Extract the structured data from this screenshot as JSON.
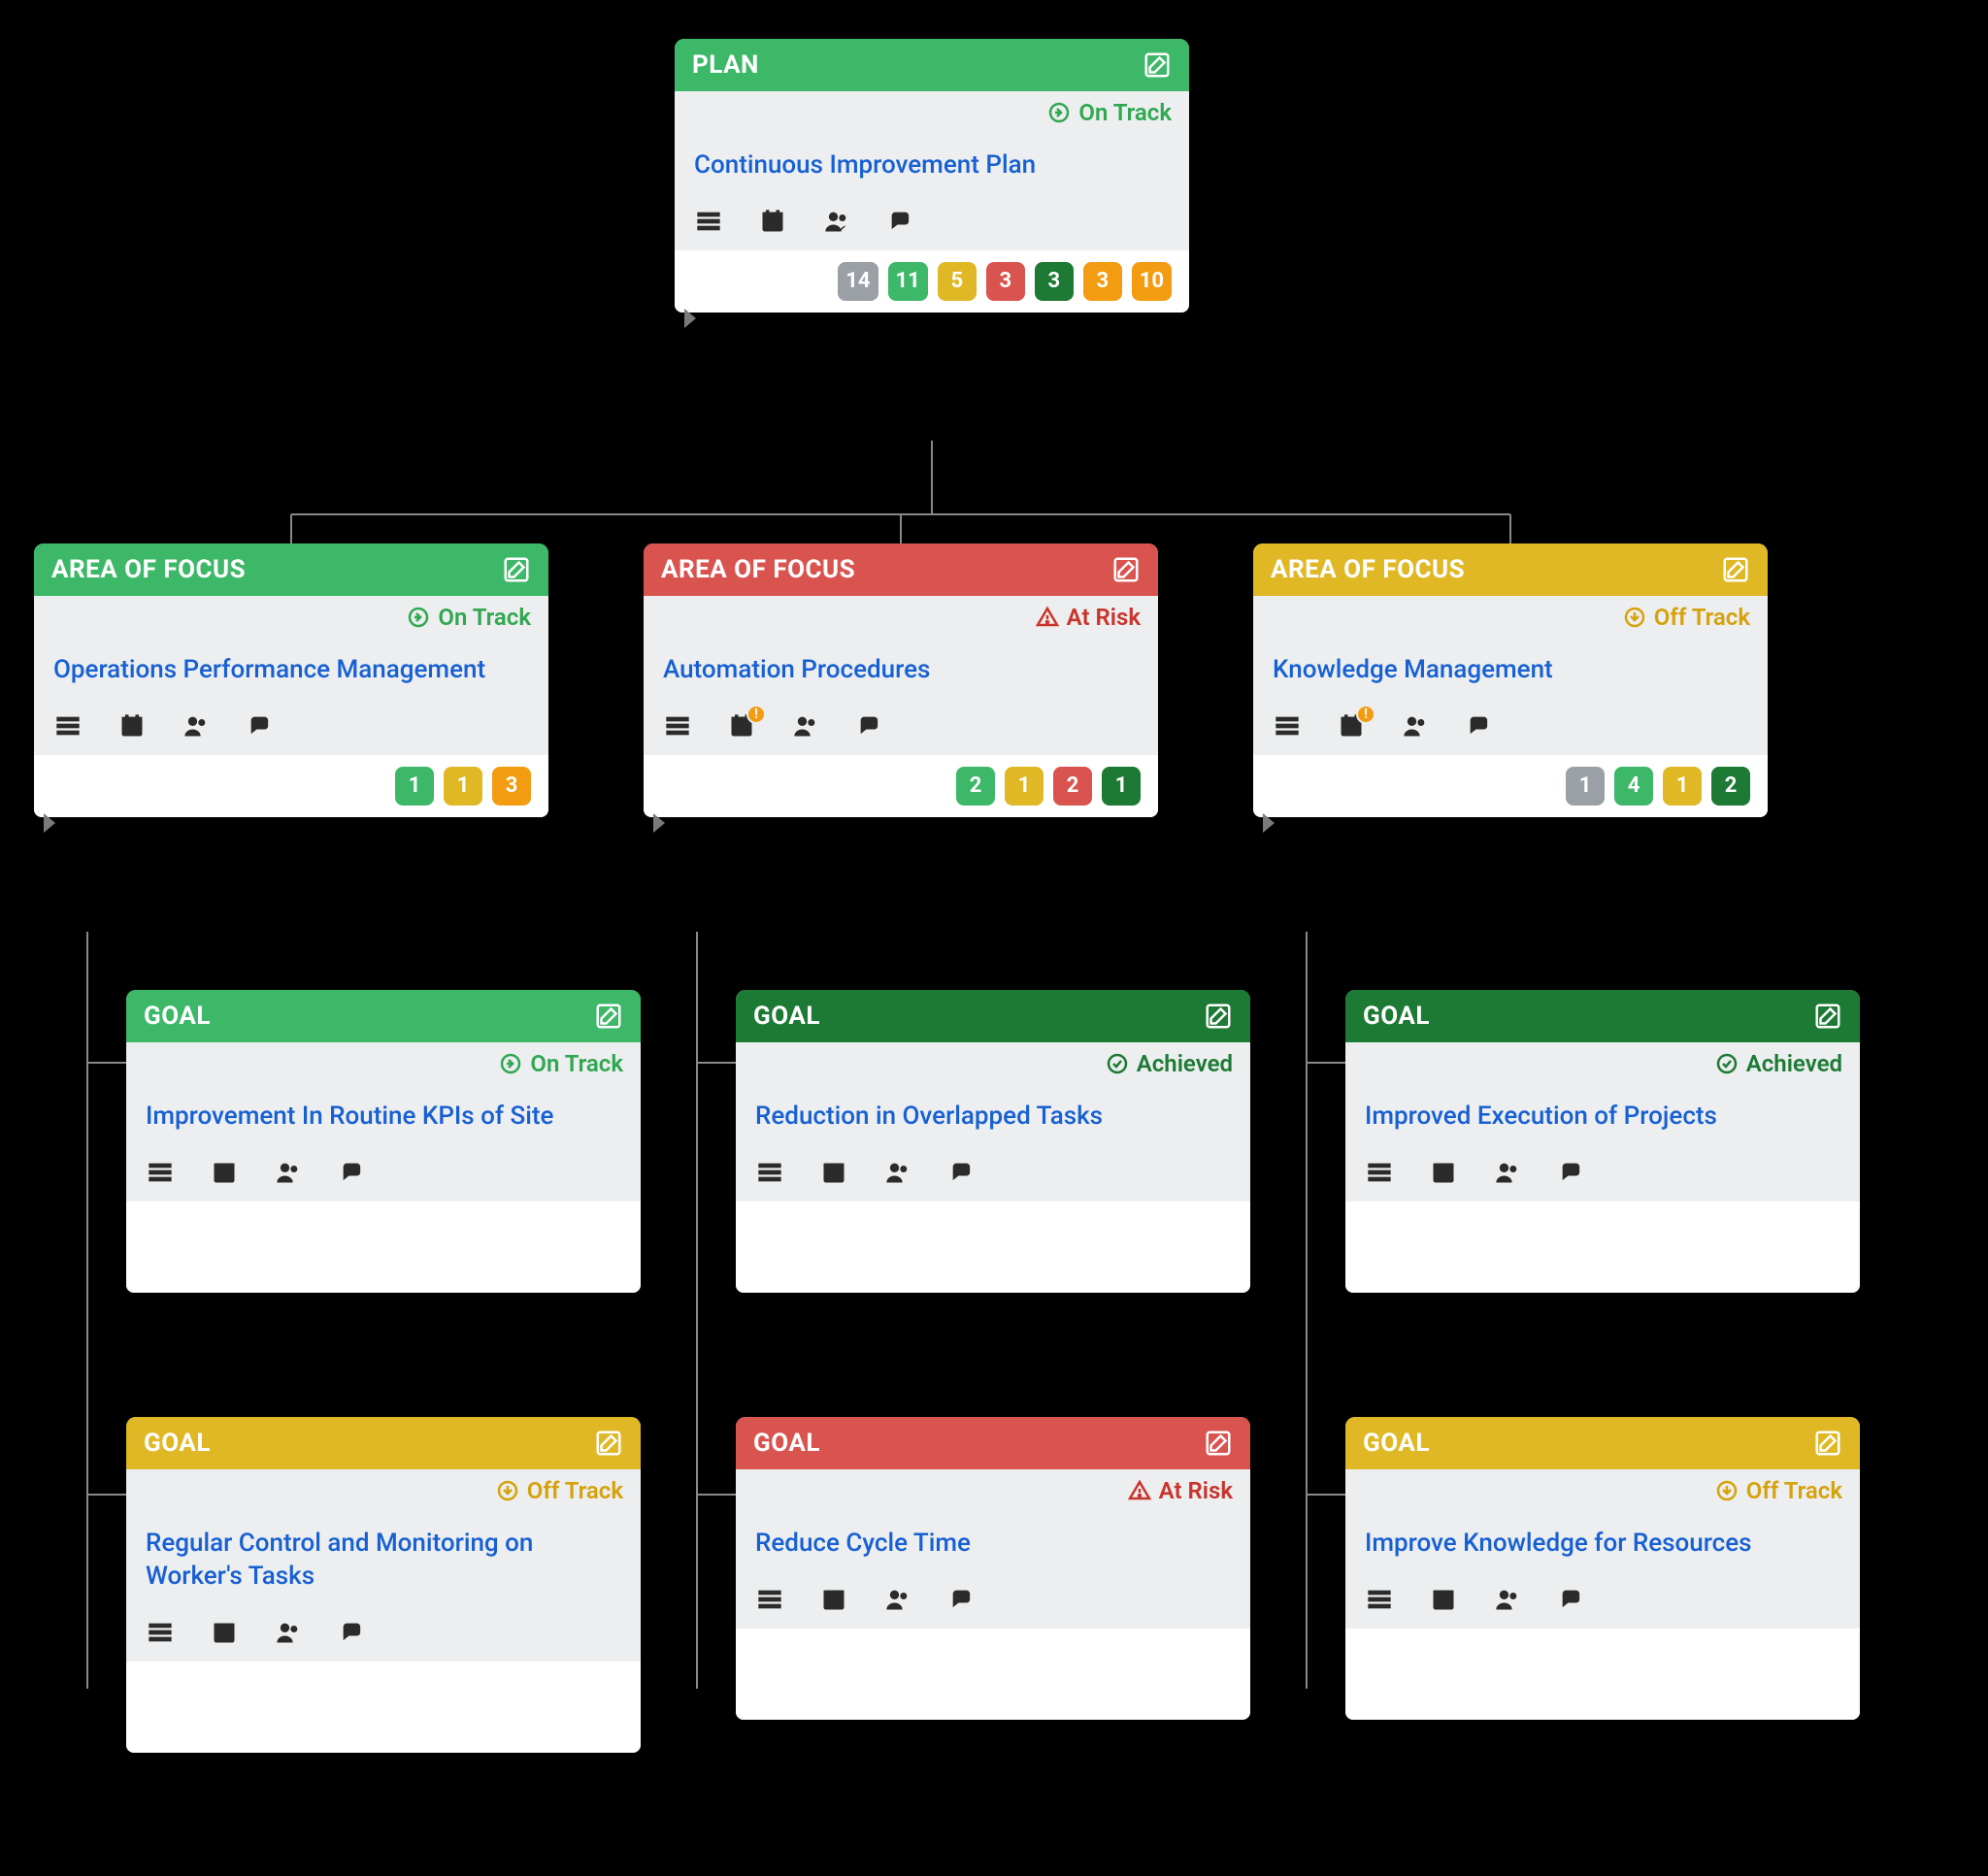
{
  "statusLabels": {
    "on_track": "On Track",
    "at_risk": "At Risk",
    "off_track": "Off Track",
    "achieved": "Achieved"
  },
  "badgeColors": {
    "gray": "#9aa0a6",
    "lgreen": "#3db868",
    "yellow": "#e0b826",
    "red": "#d9534f",
    "dgreen": "#1d7a34",
    "orange": "#f39c12"
  },
  "statusColors": {
    "on_track": "#2fa84f",
    "at_risk": "#c9342c",
    "off_track": "#d6a20b",
    "achieved": "#1d7a34"
  },
  "headerColors": {
    "green_light": "#3db868",
    "green_dark": "#1d7a34",
    "red": "#d9534f",
    "yellow": "#e0b826"
  },
  "plan": {
    "type": "PLAN",
    "title": "Continuous Improvement Plan",
    "status": "on_track",
    "counts": [
      {
        "value": 14,
        "color": "gray"
      },
      {
        "value": 11,
        "color": "lgreen"
      },
      {
        "value": 5,
        "color": "yellow"
      },
      {
        "value": 3,
        "color": "red"
      },
      {
        "value": 3,
        "color": "dgreen"
      },
      {
        "value": 3,
        "color": "orange"
      },
      {
        "value": 10,
        "color": "orange"
      }
    ]
  },
  "areas": [
    {
      "type": "AREA OF FOCUS",
      "title": "Operations Performance Management",
      "status": "on_track",
      "header_color": "green_light",
      "calendar_alert": false,
      "counts": [
        {
          "value": 1,
          "color": "lgreen"
        },
        {
          "value": 1,
          "color": "yellow"
        },
        {
          "value": 3,
          "color": "orange"
        }
      ],
      "goals": [
        {
          "type": "GOAL",
          "title": "Improvement In Routine KPIs of Site",
          "status": "on_track",
          "header_color": "green_light"
        },
        {
          "type": "GOAL",
          "title": "Regular Control and Monitoring on Worker's Tasks",
          "status": "off_track",
          "header_color": "yellow"
        }
      ]
    },
    {
      "type": "AREA OF FOCUS",
      "title": "Automation Procedures",
      "status": "at_risk",
      "header_color": "red",
      "calendar_alert": true,
      "counts": [
        {
          "value": 2,
          "color": "lgreen"
        },
        {
          "value": 1,
          "color": "yellow"
        },
        {
          "value": 2,
          "color": "red"
        },
        {
          "value": 1,
          "color": "dgreen"
        }
      ],
      "goals": [
        {
          "type": "GOAL",
          "title": "Reduction in Overlapped Tasks",
          "status": "achieved",
          "header_color": "green_dark"
        },
        {
          "type": "GOAL",
          "title": "Reduce Cycle Time",
          "status": "at_risk",
          "header_color": "red"
        }
      ]
    },
    {
      "type": "AREA OF FOCUS",
      "title": "Knowledge Management",
      "status": "off_track",
      "header_color": "yellow",
      "calendar_alert": true,
      "counts": [
        {
          "value": 1,
          "color": "gray"
        },
        {
          "value": 4,
          "color": "lgreen"
        },
        {
          "value": 1,
          "color": "yellow"
        },
        {
          "value": 2,
          "color": "dgreen"
        }
      ],
      "goals": [
        {
          "type": "GOAL",
          "title": "Improved Execution of Projects",
          "status": "achieved",
          "header_color": "green_dark"
        },
        {
          "type": "GOAL",
          "title": "Improve Knowledge for Resources",
          "status": "off_track",
          "header_color": "yellow"
        }
      ]
    }
  ]
}
